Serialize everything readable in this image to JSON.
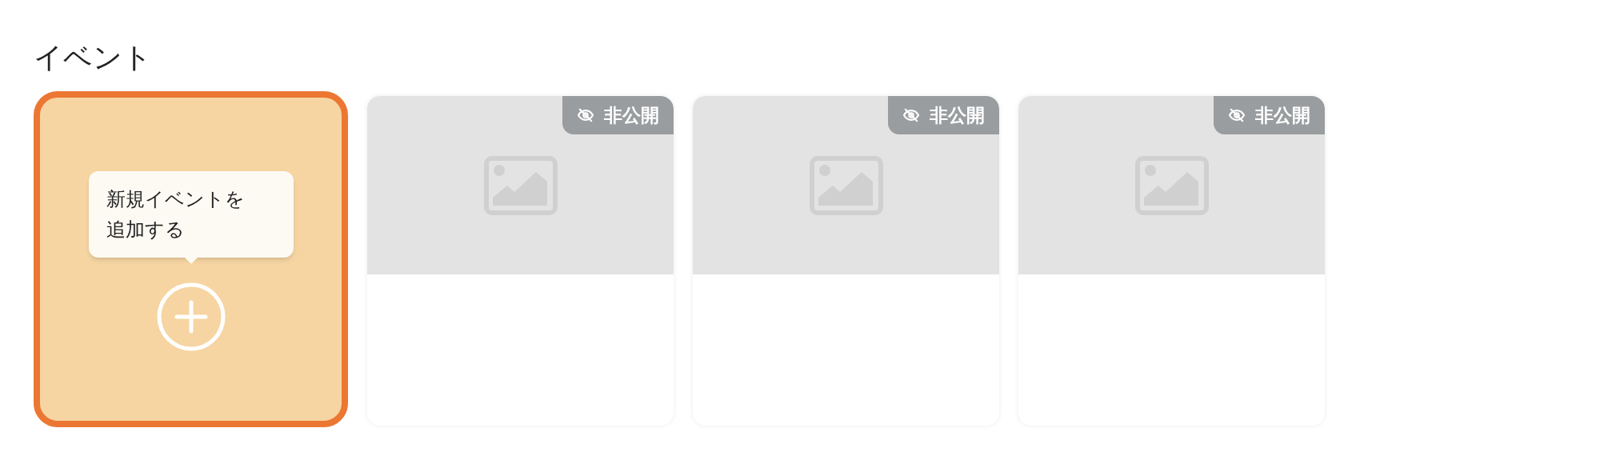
{
  "title": "イベント",
  "add_card": {
    "tooltip": "新規イベントを追加する",
    "highlighted": true
  },
  "events": [
    {
      "badge": "非公開"
    },
    {
      "badge": "非公開"
    },
    {
      "badge": "非公開"
    }
  ]
}
